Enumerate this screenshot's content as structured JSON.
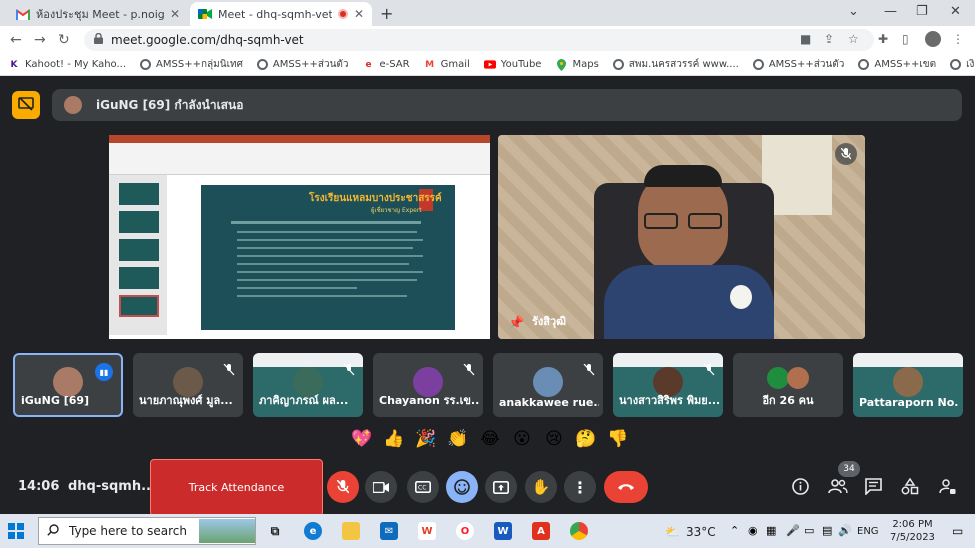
{
  "browser": {
    "tabs": [
      {
        "title": "ห้องประชุม Meet - p.noigor@gmail.c",
        "active": false
      },
      {
        "title": "Meet - dhq-sqmh-vet",
        "active": true
      }
    ],
    "url": "meet.google.com/dhq-sqmh-vet",
    "bookmarks": [
      {
        "label": "Kahoot! - My Kaho...",
        "icon": "kahoot-icon"
      },
      {
        "label": "AMSS++กลุ่มนิเทศ",
        "icon": "globe-icon"
      },
      {
        "label": "AMSS++ส่วนตัว",
        "icon": "globe-icon"
      },
      {
        "label": "e-SAR",
        "icon": "esar-icon"
      },
      {
        "label": "Gmail",
        "icon": "gmail-icon"
      },
      {
        "label": "YouTube",
        "icon": "youtube-icon"
      },
      {
        "label": "Maps",
        "icon": "maps-icon"
      },
      {
        "label": "สพม.นครสวรรค์ www....",
        "icon": "globe-icon"
      },
      {
        "label": "AMSS++ส่วนตัว",
        "icon": "globe-icon"
      },
      {
        "label": "AMSS++เขต",
        "icon": "globe-icon"
      },
      {
        "label": "เงินเดือน",
        "icon": "globe-icon"
      }
    ]
  },
  "meet": {
    "presenter_text": "iGuNG [69] กำลังนำเสนอ",
    "slide": {
      "title": "โรงเรียนแหลมบางประชาสรรค์",
      "subtitle": "ผู้เชี่ยวชาญ Expert"
    },
    "camera_name": "รังสิวุฒิ",
    "participants": [
      {
        "name": "iGuNG [69]",
        "speaking": true
      },
      {
        "name": "นายภาณุพงศ์ มูล...",
        "muted": true
      },
      {
        "name": "ภาคิญาภรณ์ ผล...",
        "muted": true
      },
      {
        "name": "Chayanon รร.เข...",
        "muted": true
      },
      {
        "name": "anakkawee rue...",
        "muted": true
      },
      {
        "name": "นางสาวสิริพร พิมย...",
        "muted": true
      },
      {
        "name": "อีก 26 คน"
      },
      {
        "name": "Pattaraporn No...",
        "muted": false
      }
    ],
    "reactions": [
      "💖",
      "👍",
      "🎉",
      "👏",
      "😂",
      "😮",
      "😢",
      "🤔",
      "👎"
    ],
    "time": "14:06",
    "meeting_code": "dhq-sqmh...",
    "track_attendance": "Track Attendance",
    "people_count": "34"
  },
  "taskbar": {
    "search_placeholder": "Type here to search",
    "temperature": "33°C",
    "language": "ENG",
    "time": "2:06 PM",
    "date": "7/5/2023"
  }
}
